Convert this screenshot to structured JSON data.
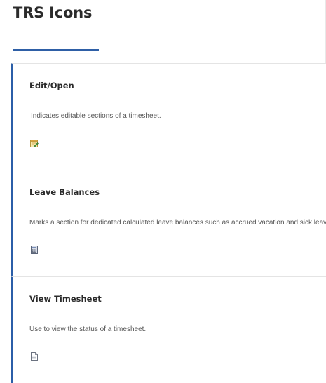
{
  "page": {
    "title": "TRS Icons"
  },
  "sections": [
    {
      "title": "Edit/Open",
      "description": "Indicates editable sections of a timesheet.",
      "icon": "edit-open-icon"
    },
    {
      "title": "Leave Balances",
      "description": "Marks a section for dedicated calculated leave balances such as accrued vacation and sick leave.",
      "icon": "calculator-icon"
    },
    {
      "title": "View Timesheet",
      "description": "Use to view the status of a timesheet.",
      "icon": "document-icon"
    }
  ],
  "colors": {
    "accent": "#2b5ea8",
    "divider": "#e4e4e4"
  }
}
